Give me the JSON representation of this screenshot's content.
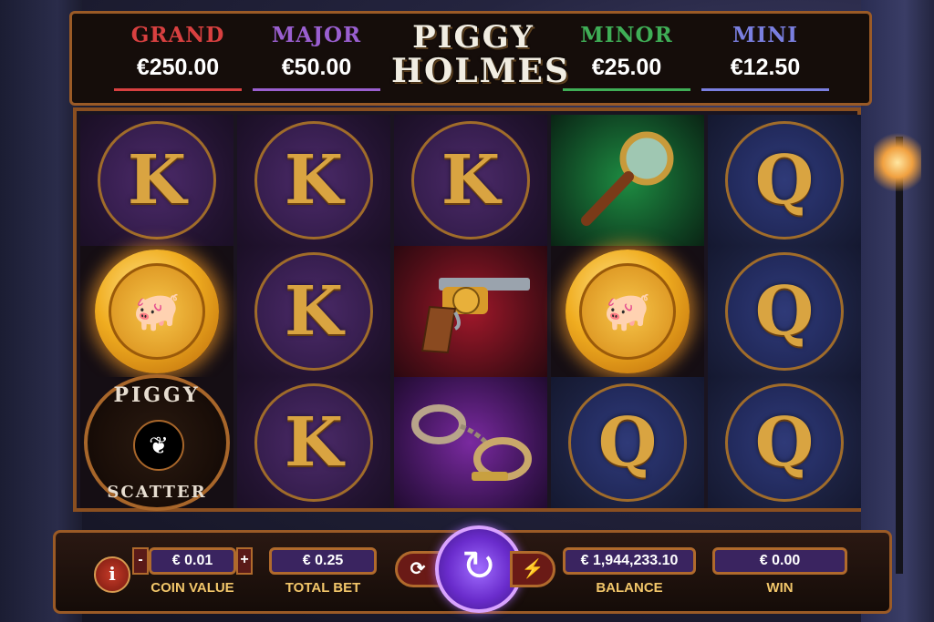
{
  "game": {
    "logo_line1": "PIGGY",
    "logo_line2": "HOLMES"
  },
  "jackpots": [
    {
      "label": "GRAND",
      "value": "€250.00",
      "color": "#d84040"
    },
    {
      "label": "MAJOR",
      "value": "€50.00",
      "color": "#9a5fd0"
    },
    {
      "label": "MINOR",
      "value": "€25.00",
      "color": "#3fae56"
    },
    {
      "label": "MINI",
      "value": "€12.50",
      "color": "#7a7fe0"
    }
  ],
  "reels": [
    [
      "K",
      "coin",
      "scatter"
    ],
    [
      "K",
      "K",
      "K"
    ],
    [
      "K",
      "revolver",
      "handcuffs"
    ],
    [
      "magnifying-glass",
      "coin",
      "Q"
    ],
    [
      "Q",
      "Q",
      "Q"
    ]
  ],
  "scatter": {
    "top": "PIGGY",
    "bottom": "SCATTER"
  },
  "controls": {
    "info_glyph": "i",
    "coin_value": "€ 0.01",
    "coin_value_label": "COIN VALUE",
    "minus": "-",
    "plus": "+",
    "total_bet": "€ 0.25",
    "total_bet_label": "TOTAL BET",
    "balance": "€ 1,944,233.10",
    "balance_label": "BALANCE",
    "win": "€ 0.00",
    "win_label": "WIN"
  }
}
